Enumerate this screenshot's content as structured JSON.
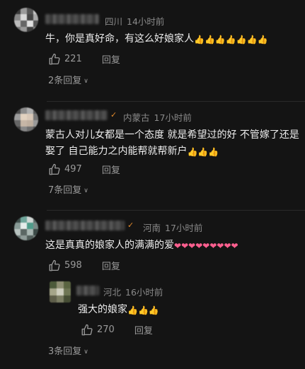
{
  "comments": [
    {
      "location": "四川",
      "time": "14小时前",
      "text": "牛，你是真好命，有这么好娘家人",
      "emoji": [
        "👍",
        "👍",
        "👍",
        "👍",
        "👍",
        "👍",
        "👍"
      ],
      "likes": "221",
      "reply_label": "回复",
      "more_replies": "2条回复"
    },
    {
      "location": "内蒙古",
      "time": "17小时前",
      "text_line1": "蒙古人对儿女都是一个态度 就是希望过的好 不管嫁了还是",
      "text_line2": "娶了 自己能力之内能帮就帮新户",
      "emoji": [
        "👍",
        "👍",
        "👍"
      ],
      "likes": "497",
      "reply_label": "回复",
      "more_replies": "7条回复"
    },
    {
      "location": "河南",
      "time": "17小时前",
      "text": "这是真真的娘家人的满满的爱",
      "hearts": [
        "❤",
        "❤",
        "❤",
        "❤",
        "❤",
        "❤",
        "❤",
        "❤",
        "❤"
      ],
      "likes": "598",
      "reply_label": "回复",
      "reply": {
        "location": "河北",
        "time": "16小时前",
        "text": "强大的娘家",
        "emoji": [
          "👍",
          "👍",
          "👍"
        ],
        "likes": "270",
        "reply_label": "回复"
      },
      "more_replies": "3条回复"
    }
  ]
}
